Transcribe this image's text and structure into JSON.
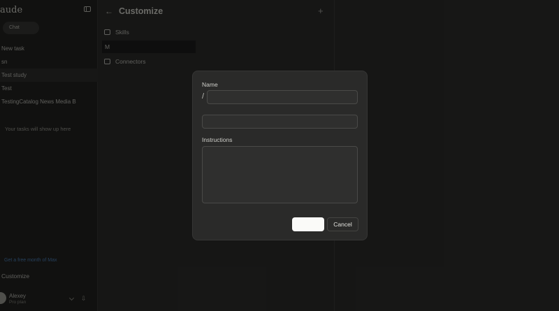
{
  "sidebar": {
    "brand": "aude",
    "chat_label": "Chat",
    "tasks": [
      "New task",
      "sn",
      "Test study",
      "Test",
      "TestingCatalog News Media B"
    ],
    "empty_text": "Your tasks will show up here",
    "promo_text": "Get a free month of Max",
    "customize_label": "Customize",
    "user": {
      "name": "Alexey",
      "plan": "Pro plan"
    }
  },
  "panel": {
    "title": "Customize",
    "nav": [
      {
        "label": "Skills"
      },
      {
        "label": "M"
      },
      {
        "label": "Connectors"
      }
    ]
  },
  "modal": {
    "name_label": "Name",
    "slash": "/",
    "name_value": "",
    "description_value": "",
    "instructions_label": "Instructions",
    "instructions_value": "",
    "primary_label": "",
    "cancel_label": "Cancel"
  },
  "colors": {
    "background": "#1a1a19",
    "sidebar": "#141413",
    "modal": "#2a2a29",
    "primary_button": "#fafaf8"
  }
}
